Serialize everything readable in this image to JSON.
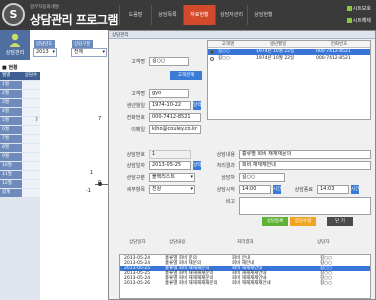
{
  "header": {
    "logo_text": "S",
    "subtitle": "업무자동화개발",
    "title": "상담관리 프로그램",
    "nav": [
      "도움말",
      "상담목록",
      "자료현황",
      "상담자관리",
      "상담현황"
    ],
    "active_nav_index": 2,
    "controls": [
      "시트보호",
      "시트해제"
    ]
  },
  "side": {
    "user_label": "상담관리",
    "year_label": "상담년도",
    "year_value": "2013",
    "type_label": "상담구분",
    "type_value": "전체",
    "status_title": "현황",
    "table_header": [
      "월별",
      "상담수"
    ],
    "rows": [
      {
        "label": "1월",
        "value": ""
      },
      {
        "label": "2월",
        "value": ""
      },
      {
        "label": "3월",
        "value": ""
      },
      {
        "label": "4월",
        "value": ""
      },
      {
        "label": "5월",
        "value": "7"
      },
      {
        "label": "6월",
        "value": ""
      },
      {
        "label": "7월",
        "value": ""
      },
      {
        "label": "8월",
        "value": ""
      },
      {
        "label": "9월",
        "value": ""
      },
      {
        "label": "10월",
        "value": ""
      },
      {
        "label": "11월",
        "value": ""
      },
      {
        "label": "12월",
        "value": ""
      },
      {
        "label": "합계",
        "value": ""
      }
    ],
    "chart_numbers": [
      "7",
      "1",
      "0",
      "-1"
    ]
  },
  "dialog": {
    "title": "상담관리",
    "customer_name_label": "고객명",
    "customer_name_value": "길○○",
    "customer_register_btn": "고객관계",
    "name_label": "고객명",
    "name_value": "gyo",
    "birth_label": "생년월일",
    "birth_value": "1974-10-22",
    "date_btn": "달력",
    "phone_label": "전화번호",
    "phone_value": "000-7412-8521",
    "email_label": "이메일",
    "email_value": "kiho@couley.co.kr",
    "grid_headers": [
      "고객명",
      "생년월일",
      "전화번호"
    ],
    "grid_rows": [
      {
        "name": "길○○",
        "birth": "1974년 10월 22일",
        "phone": "000-7412-8521",
        "selected": true
      },
      {
        "name": "길○○",
        "birth": "1974년 10월 22일",
        "phone": "000-7412-8521",
        "selected": false
      }
    ],
    "consult_no_label": "상담번호",
    "consult_no_value": "1",
    "consult_date_label": "상담일자",
    "consult_date_value": "2013-05-25",
    "consult_type_label": "상담구분",
    "consult_type_value": "불랙리스트",
    "detail_label": "세부항목",
    "detail_value": "진상",
    "consult_content_label": "상담내용",
    "consult_content_value": "흉류별 회비 재재재문의",
    "process_result_label": "처리결과",
    "process_result_value": "회비 재재재안내",
    "counselor_label": "상담자",
    "counselor_value": "길○○",
    "start_label": "상담시작",
    "start_value": "14:00",
    "end_label": "상담종료",
    "end_value": "14:03",
    "time_btn": "시간",
    "note_label": "비고",
    "note_value": "",
    "btn_register": "상담등록",
    "btn_modify": "상담수정",
    "btn_close": "닫 기",
    "list_headers": [
      "상담일자",
      "상담내용",
      "처리결과",
      "상담자"
    ],
    "list_rows": [
      {
        "date": "2013-05-24",
        "content": "흉류별 회비 문의",
        "result": "회비 안내",
        "person": "길○○",
        "selected": false
      },
      {
        "date": "2013-05-24",
        "content": "흉류별 회비 재문의",
        "result": "회비 재안내",
        "person": "길○○",
        "selected": false
      },
      {
        "date": "2013-05-25",
        "content": "흉류별 회비 재재재문의",
        "result": "회비 재재재안내",
        "person": "길○○",
        "selected": true
      },
      {
        "date": "2013-05-25",
        "content": "흉류별 회비 재재재재문의",
        "result": "회비 재재재재안내",
        "person": "길○○",
        "selected": false
      },
      {
        "date": "2013-05-24",
        "content": "흉류별 회비 재재재재문의",
        "result": "회비 재재재재안내",
        "person": "길○○",
        "selected": false
      },
      {
        "date": "2013-05-26",
        "content": "흉류별 회비 재재재재재문의",
        "result": "회비 재재재재재안내",
        "person": "길○○",
        "selected": false
      }
    ]
  },
  "colors": {
    "accent": "#d34a2a",
    "header_bg": "#3a3a3a",
    "side_blue": "#4f6fa1",
    "green": "#5fb233",
    "orange": "#f0a51e",
    "blue": "#3a7bd5"
  }
}
